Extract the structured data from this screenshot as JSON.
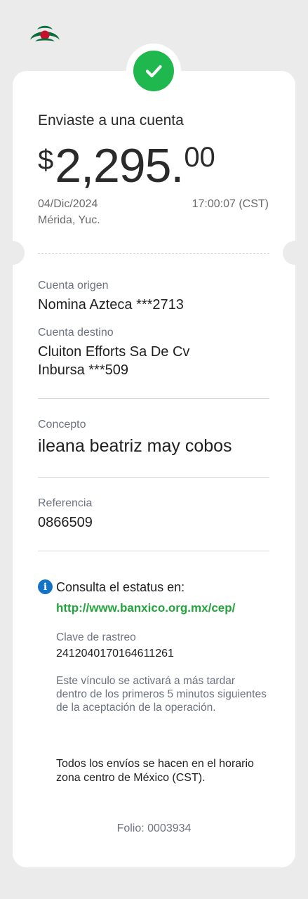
{
  "header": {
    "logo_icon": "bank-logo-icon",
    "success_icon": "check-circle-icon",
    "success_color": "#1fb84f"
  },
  "receipt": {
    "title": "Enviaste a una cuenta",
    "amount": {
      "currency": "$",
      "integer": "2,295.",
      "decimals": "00"
    },
    "date": "04/Dic/2024",
    "time": "17:00:07 (CST)",
    "location": "Mérida, Yuc."
  },
  "accounts": {
    "origin_label": "Cuenta origen",
    "origin_value": "Nomina Azteca ***2713",
    "dest_label": "Cuenta destino",
    "dest_line1": "Cluiton Efforts Sa De Cv",
    "dest_line2": "Inbursa ***509"
  },
  "concept": {
    "label": "Concepto",
    "value": "ileana beatriz may cobos"
  },
  "reference": {
    "label": "Referencia",
    "value": "0866509"
  },
  "status": {
    "info_icon": "info-icon",
    "consult_text": "Consulta el estatus en:",
    "url": "http://www.banxico.org.mx/cep/",
    "tracking_label": "Clave de rastreo",
    "tracking_value": "2412040170164611261",
    "activation_note": "Este vínculo se activará a más tardar dentro de los primeros 5 minutos siguientes de la aceptación de la operación.",
    "schedule_note": "Todos los envíos se hacen en el horario zona centro de México (CST)."
  },
  "footer": {
    "folio": "Folio: 0003934"
  },
  "colors": {
    "accent_green": "#23a33c",
    "info_blue": "#1673c4",
    "background": "#ebebeb"
  }
}
